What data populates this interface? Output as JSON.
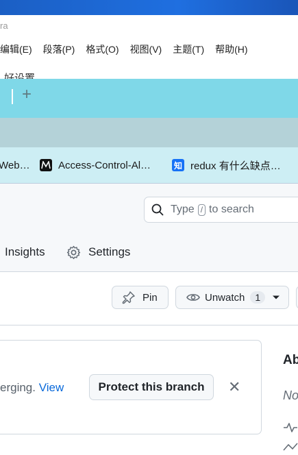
{
  "desktop": {
    "typora_title": "ra"
  },
  "menu": {
    "items": [
      "编辑(E)",
      "段落(P)",
      "格式(O)",
      "视图(V)",
      "主题(T)",
      "帮助(H)"
    ],
    "partial": "好设置"
  },
  "browser": {
    "new_tab": "+",
    "bookmarks": [
      {
        "label": "Web…",
        "icon": "partial"
      },
      {
        "label": "Access-Control-Al…",
        "icon": "M",
        "icon_color": "#111111"
      },
      {
        "label": "redux 有什么缺点…",
        "icon": "知",
        "icon_color": "#1772f6"
      }
    ]
  },
  "github": {
    "search": {
      "before": "Type",
      "key": "/",
      "after": "to search"
    },
    "nav": {
      "insights": "Insights",
      "settings": "Settings"
    },
    "actions": {
      "pin": "Pin",
      "unwatch": "Unwatch",
      "watch_count": "1"
    },
    "banner": {
      "text": "erging.",
      "link": "View",
      "button": "Protect this branch",
      "close": "✕"
    },
    "sidebar": {
      "about_partial": "Ab",
      "no_partial": "No"
    }
  }
}
